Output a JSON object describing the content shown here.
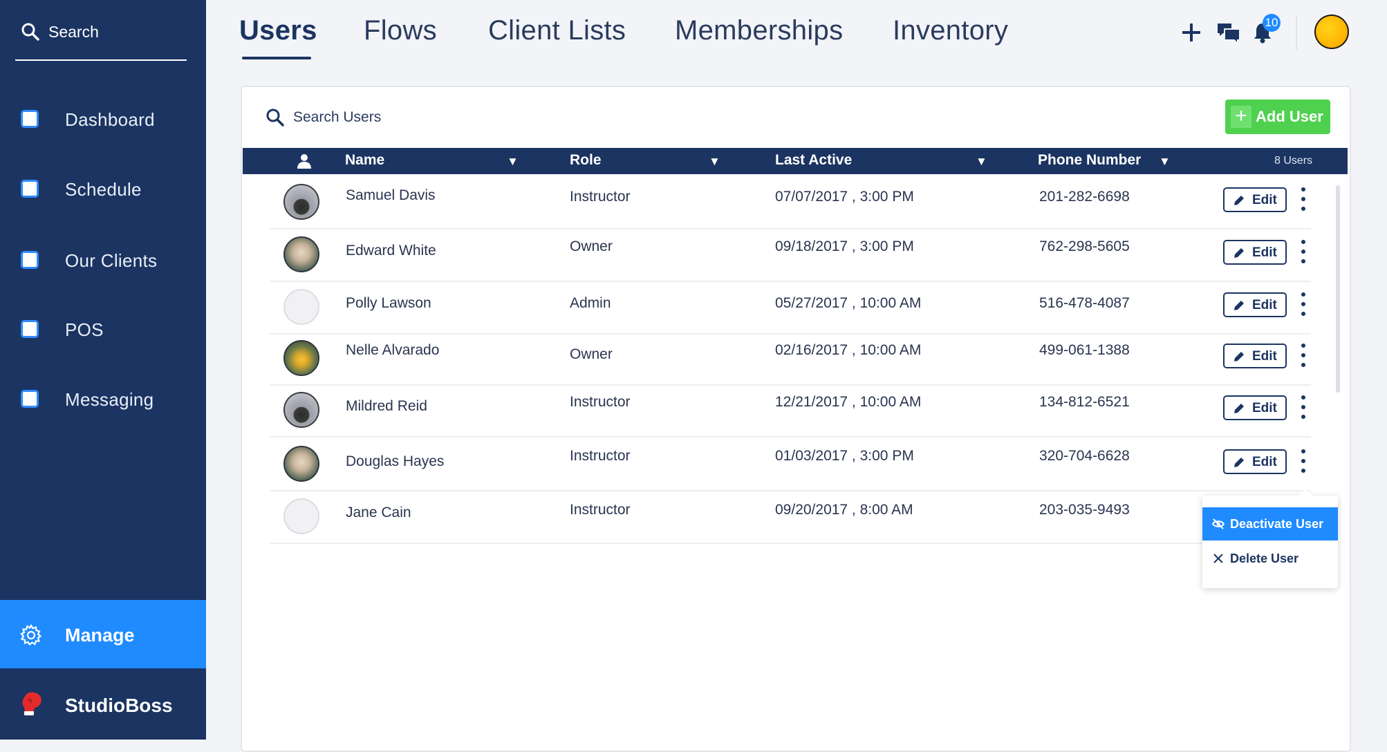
{
  "sidebar": {
    "search_label": "Search",
    "items": [
      {
        "label": "Dashboard"
      },
      {
        "label": "Schedule"
      },
      {
        "label": "Our Clients"
      },
      {
        "label": "POS"
      },
      {
        "label": "Messaging"
      }
    ],
    "manage_label": "Manage",
    "brand_label": "StudioBoss"
  },
  "tabs": [
    {
      "label": "Users",
      "active": true
    },
    {
      "label": "Flows"
    },
    {
      "label": "Client Lists"
    },
    {
      "label": "Memberships"
    },
    {
      "label": "Inventory"
    }
  ],
  "header": {
    "notification_count": "10",
    "icons": [
      "plus-icon",
      "chat-icon",
      "bell-icon",
      "user-avatar"
    ]
  },
  "users_panel": {
    "search_placeholder": "Search Users",
    "add_button_label": "Add User",
    "columns": [
      "Name",
      "Role",
      "Last Active",
      "Phone Number"
    ],
    "user_count": "8 Users",
    "edit_label": "Edit",
    "rows": [
      {
        "name": "Samuel Davis",
        "role": "Instructor",
        "last_active": "07/07/2017 , 3:00 PM",
        "phone": "201-282-6698",
        "avatar": "dark"
      },
      {
        "name": "Edward White",
        "role": "Owner",
        "last_active": "09/18/2017 , 3:00 PM",
        "phone": "762-298-5605",
        "avatar": "photo"
      },
      {
        "name": "Polly Lawson",
        "role": "Admin",
        "last_active": "05/27/2017 , 10:00 AM",
        "phone": "516-478-4087",
        "avatar": "blank"
      },
      {
        "name": "Nelle Alvarado",
        "role": "Owner",
        "last_active": "02/16/2017 , 10:00 AM",
        "phone": "499-061-1388",
        "avatar": "sun"
      },
      {
        "name": "Mildred Reid",
        "role": "Instructor",
        "last_active": "12/21/2017 , 10:00 AM",
        "phone": "134-812-6521",
        "avatar": "dark"
      },
      {
        "name": "Douglas Hayes",
        "role": "Instructor",
        "last_active": "01/03/2017 , 3:00 PM",
        "phone": "320-704-6628",
        "avatar": "photo"
      },
      {
        "name": "Jane Cain",
        "role": "Instructor",
        "last_active": "09/20/2017 , 8:00 AM",
        "phone": "203-035-9493",
        "avatar": "blank"
      }
    ]
  },
  "row_menu": {
    "items": [
      {
        "label": "Deactivate User",
        "icon": "eye-off-icon",
        "active": true
      },
      {
        "label": "Delete User",
        "icon": "close-icon"
      }
    ]
  },
  "colors": {
    "sidebar": "#1b3461",
    "accent": "#1f8bff",
    "add_button": "#4fd14f"
  }
}
